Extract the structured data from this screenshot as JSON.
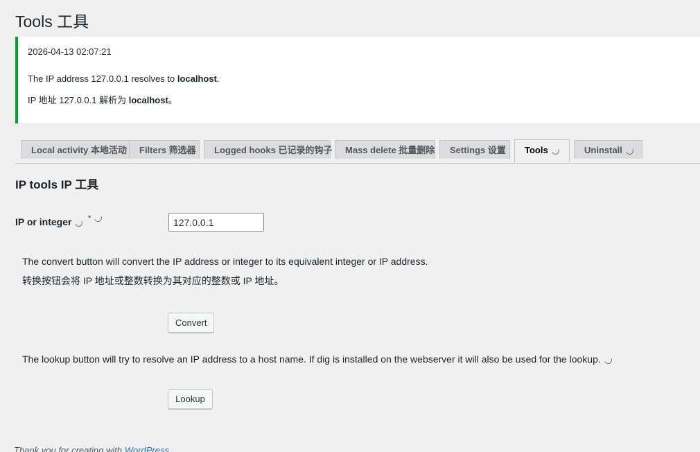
{
  "page": {
    "title": "Tools 工具"
  },
  "notice": {
    "timestamp": "2026-04-13 02:07:21",
    "line1_prefix": "The IP address 127.0.0.1 resolves to ",
    "line1_host": "localhost",
    "line1_suffix": ".",
    "line2_prefix": "IP 地址 127.0.0.1 解析为 ",
    "line2_host": "localhost",
    "line2_suffix": "。",
    "accent_color": "#00a32a"
  },
  "tabs": [
    {
      "label": "Local activity 本地活动",
      "active": false
    },
    {
      "label": "Filters 筛选器",
      "active": false
    },
    {
      "label": "Logged hooks 已记录的钩子",
      "active": false
    },
    {
      "label": "Mass delete 批量删除",
      "active": false
    },
    {
      "label": "Settings 设置",
      "active": false
    },
    {
      "label": "Tools",
      "active": true
    },
    {
      "label": "Uninstall",
      "active": false
    }
  ],
  "section": {
    "title": "IP tools IP 工具"
  },
  "form": {
    "field_label": "IP or integer",
    "required_mark": "*",
    "ip_value": "127.0.0.1",
    "convert_desc_en": "The convert button will convert the IP address or integer to its equivalent integer or IP address.",
    "convert_desc_zh": "转换按钮会将 IP 地址或整数转换为其对应的整数或 IP 地址。",
    "convert_label": "Convert",
    "lookup_desc": "The lookup button will try to resolve an IP address to a host name. If dig is installed on the webserver it will also be used for the lookup.",
    "lookup_label": "Lookup"
  },
  "footer": {
    "text": "Thank you for creating with ",
    "link": "WordPress"
  }
}
